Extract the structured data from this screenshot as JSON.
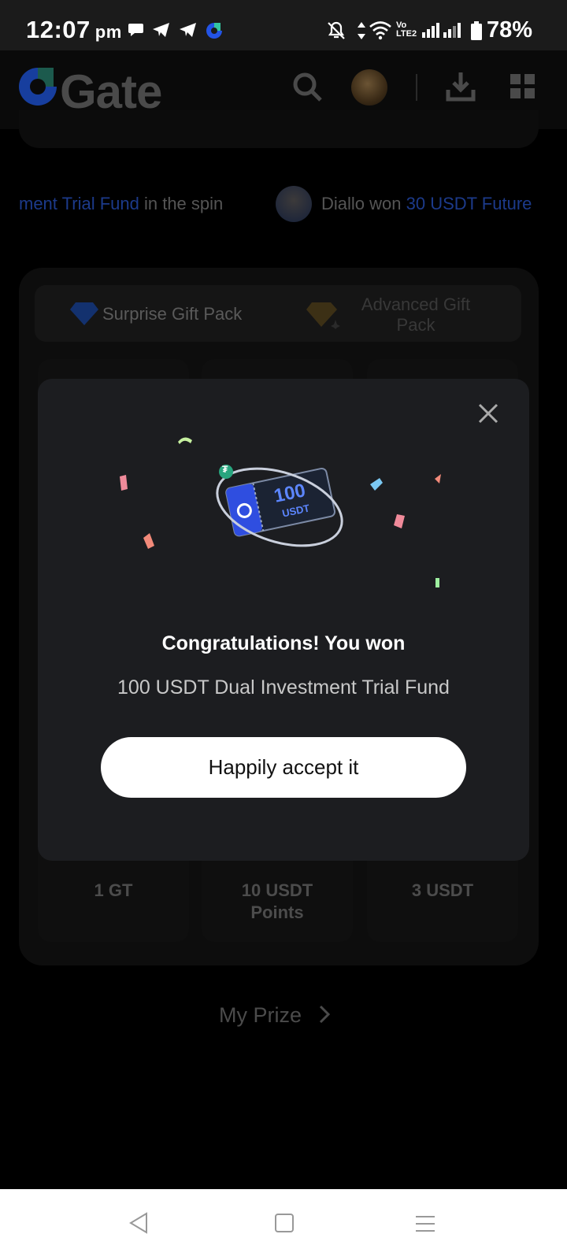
{
  "status_bar": {
    "time": "12:07",
    "ampm": "pm",
    "battery": "78%"
  },
  "header": {
    "logo": "Gate",
    "icons": [
      "search-icon",
      "avatar",
      "download-icon",
      "apps-grid-icon"
    ]
  },
  "ticker": {
    "left_highlight": "ment Trial Fund",
    "left_rest": "in the spin",
    "right_name": "Diallo won",
    "right_highlight": "30 USDT Future"
  },
  "tabs": [
    {
      "label": "Surprise Gift Pack"
    },
    {
      "label_line1": "Advanced Gift",
      "label_line2": "Pack"
    }
  ],
  "prizes": [
    {
      "line1": "1 GT",
      "line2": ""
    },
    {
      "line1": "10 USDT",
      "line2": "Points"
    },
    {
      "line1": "3 USDT",
      "line2": ""
    }
  ],
  "my_prize": "My Prize",
  "modal": {
    "ticket_amount": "100",
    "ticket_unit": "USDT",
    "title": "Congratulations! You won",
    "subtitle": "100 USDT Dual Investment Trial Fund",
    "accept_label": "Happily accept it"
  },
  "colors": {
    "accent_blue": "#2354e6",
    "highlight_dim_blue": "#1c3a8a",
    "modal_bg": "#1c1d20"
  }
}
